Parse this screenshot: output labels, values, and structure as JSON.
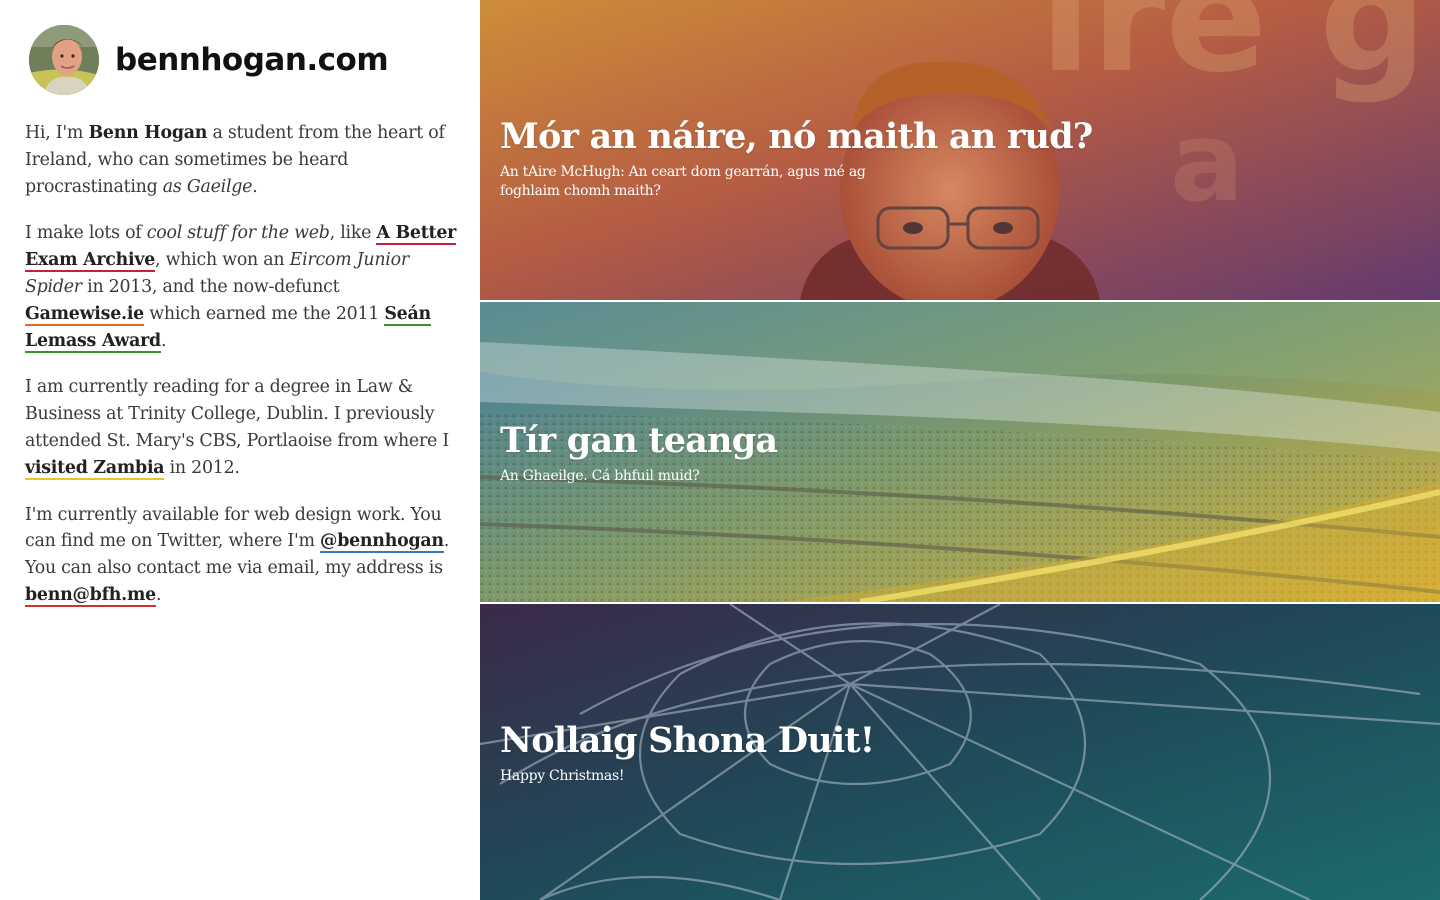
{
  "site": {
    "name": "bennhogan.com"
  },
  "bio": {
    "p1": {
      "t1": "Hi, I'm ",
      "name": "Benn Hogan",
      "t2": " a student from the heart of Ireland, who can sometimes be heard procrastinating ",
      "em": "as Gaeilge",
      "t3": "."
    },
    "p2": {
      "t1": "I make lots of ",
      "em1": "cool stuff for the web",
      "t2": ", like ",
      "link1": "A Better Exam Archive",
      "t3": ", which won an ",
      "em2": "Eircom Junior Spider",
      "t4": " in 2013, and the now-defunct ",
      "link2": "Gamewise.ie",
      "t5": " which earned me the 2011 ",
      "link3": "Seán Lemass Award",
      "t6": "."
    },
    "p3": {
      "t1": "I am currently reading for a degree in Law & Business at Trinity College, Dublin. I previously attended St. Mary's CBS, Portlaoise from where I ",
      "link1": "visited Zambia",
      "t2": " in 2012."
    },
    "p4": {
      "t1": "I'm currently available for web design work. You can find me on Twitter, where I'm ",
      "link1": "@bennhogan",
      "t2": ". You can also contact me via email, my address is ",
      "link2": "benn@bfh.me",
      "t3": "."
    }
  },
  "link_colors": {
    "exam_archive": "#c8203a",
    "gamewise": "#e2692a",
    "lemass": "#3e8f2d",
    "zambia": "#e8c62a",
    "twitter": "#3b78c2",
    "email": "#d3302e"
  },
  "posts": [
    {
      "title": "Mór an náire, nó maith an rud?",
      "subtitle": "An tAire McHugh: An ceart dom gearrán, agus mé ag foghlaim chomh maith?",
      "image": "portrait-photo",
      "tint": [
        "#d98a3a",
        "#7a4a78"
      ]
    },
    {
      "title": "Tír gan teanga",
      "subtitle": "An Ghaeilge. Cá bhfuil muid?",
      "image": "railway-photo",
      "tint": [
        "#3f7fa0",
        "#d6b43a"
      ]
    },
    {
      "title": "Nollaig Shona Duit!",
      "subtitle": "Happy Christmas!",
      "image": "spiderweb-photo",
      "tint": [
        "#3a2a4a",
        "#1f6a6a"
      ]
    }
  ]
}
